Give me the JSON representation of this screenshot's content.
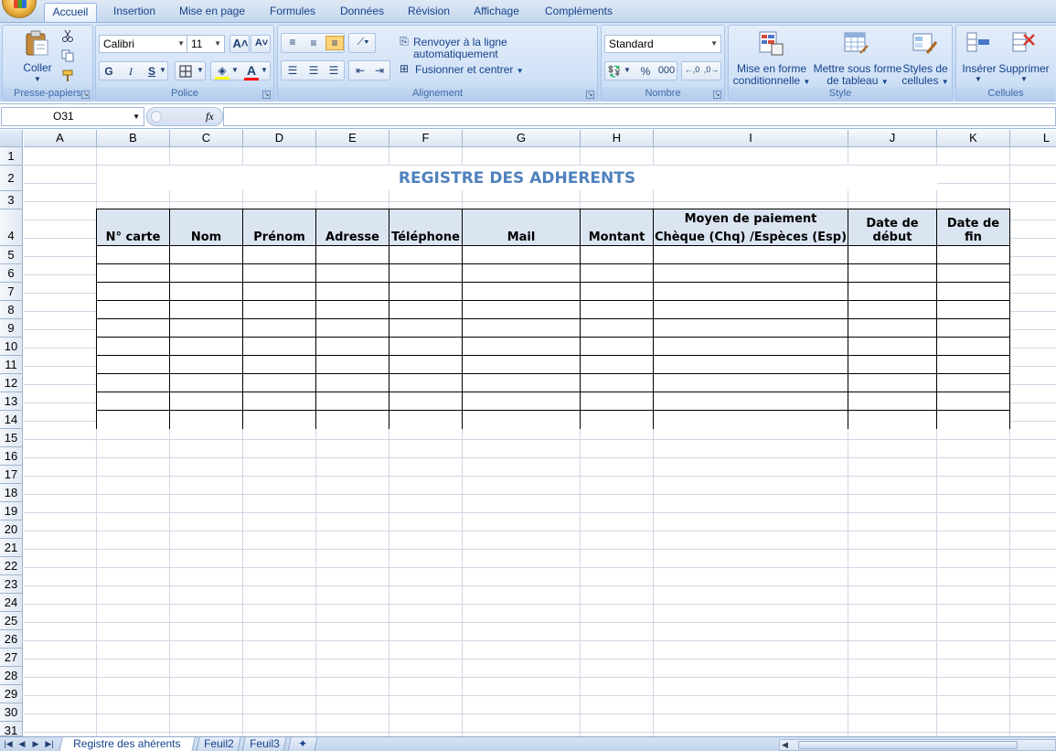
{
  "ribbon_tabs": [
    "Accueil",
    "Insertion",
    "Mise en page",
    "Formules",
    "Données",
    "Révision",
    "Affichage",
    "Compléments"
  ],
  "clipboard": {
    "coller": "Coller",
    "label": "Presse-papiers"
  },
  "police": {
    "font": "Calibri",
    "size": "11",
    "bold": "G",
    "italic": "I",
    "underline": "S",
    "label": "Police"
  },
  "alignement": {
    "wrap": "Renvoyer à la ligne automatiquement",
    "merge": "Fusionner et centrer",
    "label": "Alignement"
  },
  "nombre": {
    "format": "Standard",
    "percent": "%",
    "thousands": "000",
    "label": "Nombre"
  },
  "style": {
    "cond_l1": "Mise en forme",
    "cond_l2": "conditionnelle",
    "table_l1": "Mettre sous forme",
    "table_l2": "de tableau",
    "cell_l1": "Styles de",
    "cell_l2": "cellules",
    "label": "Style"
  },
  "cellules": {
    "insert": "Insérer",
    "delete": "Supprimer",
    "label": "Cellules"
  },
  "formula_bar": {
    "name_box": "O31",
    "fx": "fx",
    "content": ""
  },
  "columns": [
    "A",
    "B",
    "C",
    "D",
    "E",
    "F",
    "G",
    "H",
    "I",
    "J",
    "K",
    "L"
  ],
  "rows": [
    "1",
    "2",
    "3",
    "4",
    "5",
    "6",
    "7",
    "8",
    "9",
    "10",
    "11",
    "12",
    "13",
    "14",
    "15",
    "16",
    "17",
    "18",
    "19",
    "20",
    "21",
    "22",
    "23",
    "24",
    "25",
    "26",
    "27",
    "28",
    "29",
    "30",
    "31"
  ],
  "sheet": {
    "title": "REGISTRE DES ADHERENTS",
    "headers": [
      "N° carte",
      "Nom",
      "Prénom",
      "Adresse",
      "Téléphone",
      "Mail",
      "Montant",
      "Moyen de paiement",
      "Date de début",
      "Date de fin"
    ],
    "payment_subheader": "Chèque (Chq) /Espèces (Esp)",
    "empty_rows": 10
  },
  "sheet_tabs": [
    "Registre des ahérents",
    "Feuil2",
    "Feuil3"
  ],
  "colors": {
    "title": "#4f81bd",
    "header_fill": "#dbe5f1",
    "grid": "#d0d7e5"
  }
}
